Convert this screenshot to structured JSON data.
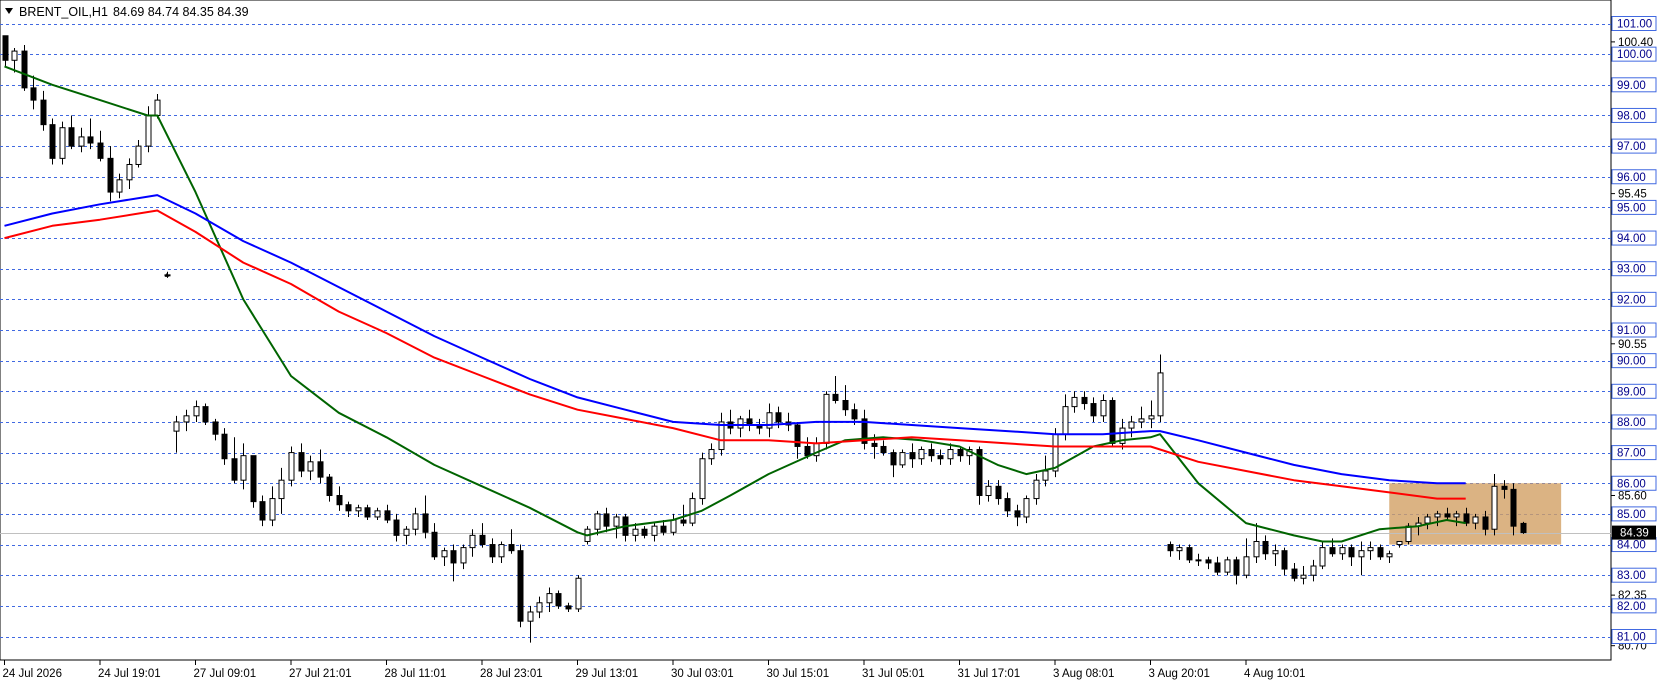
{
  "header": {
    "symbol": "BRENT_OIL,H1",
    "ohlc": "84.69 84.74 84.35 84.39"
  },
  "colors": {
    "candle": "#000000",
    "grid_line": "#4169e1",
    "ma_blue": "#0000ff",
    "ma_red": "#ff0000",
    "ma_green": "#006400",
    "zone": "#d2a064",
    "level_label_bg": "#ffffff",
    "level_label_border": "#4169e1",
    "level_label_text": "#00008b",
    "price_tag_bg": "#000000",
    "price_tag_text": "#ffffff"
  },
  "chart_data": {
    "type": "candlestick",
    "timeframe": "H1",
    "ylim": [
      80.7,
      101.3
    ],
    "current_price": 84.39,
    "level_lines": [
      101.0,
      100.0,
      99.0,
      98.0,
      97.0,
      96.0,
      95.0,
      94.0,
      93.0,
      92.0,
      91.0,
      90.0,
      89.0,
      88.0,
      87.0,
      86.0,
      85.0,
      84.0,
      83.0,
      82.0,
      81.0
    ],
    "level_labels": [
      "101.00",
      "100.00",
      "99.00",
      "98.00",
      "97.00",
      "96.00",
      "95.00",
      "94.00",
      "93.00",
      "92.00",
      "91.00",
      "90.00",
      "89.00",
      "88.00",
      "87.00",
      "86.00",
      "85.00",
      "84.00",
      "83.00",
      "82.00",
      "81.00"
    ],
    "y_ticks": [
      100.4,
      95.45,
      90.55,
      85.6,
      82.35,
      80.7
    ],
    "y_tick_labels": [
      "100.40",
      "95.45",
      "90.55",
      "85.60",
      "82.35",
      "80.70"
    ],
    "x_ticks": [
      0,
      10,
      20,
      30,
      40,
      50,
      60,
      70,
      80,
      90,
      100,
      110,
      120,
      130
    ],
    "x_tick_labels": [
      "24 Jul 2026",
      "24 Jul 19:01",
      "27 Jul 09:01",
      "27 Jul 21:01",
      "28 Jul 11:01",
      "28 Jul 23:01",
      "29 Jul 13:01",
      "30 Jul 03:01",
      "30 Jul 15:01",
      "31 Jul 05:01",
      "31 Jul 17:01",
      "3 Aug 08:01",
      "3 Aug 20:01",
      "4 Aug 10:01"
    ],
    "candles": [
      [
        100.6,
        100.6,
        99.6,
        99.8
      ],
      [
        99.8,
        100.2,
        99.4,
        100.1
      ],
      [
        100.1,
        100.3,
        98.8,
        98.9
      ],
      [
        98.9,
        99.3,
        98.2,
        98.5
      ],
      [
        98.5,
        98.8,
        97.5,
        97.7
      ],
      [
        97.7,
        97.9,
        96.4,
        96.6
      ],
      [
        96.6,
        97.8,
        96.4,
        97.6
      ],
      [
        97.6,
        98.0,
        96.9,
        97.0
      ],
      [
        97.0,
        97.6,
        96.8,
        97.3
      ],
      [
        97.3,
        97.9,
        96.9,
        97.1
      ],
      [
        97.1,
        97.5,
        96.5,
        96.6
      ],
      [
        96.6,
        97.0,
        95.2,
        95.5
      ],
      [
        95.5,
        96.1,
        95.3,
        95.9
      ],
      [
        95.9,
        96.6,
        95.6,
        96.4
      ],
      [
        96.4,
        97.2,
        96.3,
        97.0
      ],
      [
        97.0,
        98.3,
        96.8,
        98.0
      ],
      [
        98.0,
        98.7,
        97.9,
        98.5
      ],
      [
        92.8,
        92.9,
        92.7,
        92.8
      ],
      [
        87.7,
        88.2,
        87.0,
        88.0
      ],
      [
        88.0,
        88.4,
        87.7,
        88.2
      ],
      [
        88.2,
        88.7,
        88.0,
        88.5
      ],
      [
        88.5,
        88.6,
        87.9,
        88.0
      ],
      [
        88.0,
        88.1,
        87.4,
        87.6
      ],
      [
        87.6,
        87.8,
        86.6,
        86.8
      ],
      [
        86.8,
        87.5,
        86.0,
        86.1
      ],
      [
        86.1,
        87.3,
        85.8,
        86.9
      ],
      [
        86.9,
        86.9,
        85.2,
        85.4
      ],
      [
        85.4,
        85.6,
        84.6,
        84.8
      ],
      [
        84.8,
        85.9,
        84.6,
        85.5
      ],
      [
        85.5,
        86.5,
        85.0,
        86.1
      ],
      [
        86.1,
        87.2,
        85.9,
        87.0
      ],
      [
        87.0,
        87.3,
        86.2,
        86.4
      ],
      [
        86.4,
        86.9,
        86.1,
        86.7
      ],
      [
        86.7,
        87.1,
        86.0,
        86.2
      ],
      [
        86.2,
        86.3,
        85.4,
        85.6
      ],
      [
        85.6,
        85.9,
        85.1,
        85.3
      ],
      [
        85.3,
        85.4,
        84.9,
        85.1
      ],
      [
        85.1,
        85.3,
        84.9,
        85.2
      ],
      [
        85.2,
        85.3,
        84.8,
        84.9
      ],
      [
        84.9,
        85.2,
        84.8,
        85.1
      ],
      [
        85.1,
        85.3,
        84.7,
        84.8
      ],
      [
        84.8,
        85.0,
        84.1,
        84.3
      ],
      [
        84.3,
        84.6,
        84.0,
        84.5
      ],
      [
        84.5,
        85.2,
        84.3,
        85.0
      ],
      [
        85.0,
        85.6,
        84.2,
        84.4
      ],
      [
        84.4,
        84.7,
        83.5,
        83.6
      ],
      [
        83.6,
        83.9,
        83.3,
        83.8
      ],
      [
        83.8,
        84.0,
        82.8,
        83.4
      ],
      [
        83.4,
        84.0,
        83.2,
        83.9
      ],
      [
        83.9,
        84.5,
        83.6,
        84.3
      ],
      [
        84.3,
        84.7,
        83.9,
        84.0
      ],
      [
        84.0,
        84.2,
        83.4,
        83.6
      ],
      [
        83.6,
        84.1,
        83.4,
        84.0
      ],
      [
        84.0,
        84.5,
        83.7,
        83.8
      ],
      [
        83.8,
        84.0,
        81.3,
        81.5
      ],
      [
        81.5,
        82.0,
        80.8,
        81.8
      ],
      [
        81.8,
        82.3,
        81.6,
        82.1
      ],
      [
        82.1,
        82.6,
        81.8,
        82.4
      ],
      [
        82.4,
        82.5,
        81.9,
        82.0
      ],
      [
        82.0,
        82.1,
        81.8,
        81.9
      ],
      [
        81.9,
        83.0,
        81.8,
        82.9
      ],
      [
        84.1,
        84.6,
        84.0,
        84.5
      ],
      [
        84.5,
        85.1,
        84.3,
        85.0
      ],
      [
        85.0,
        85.2,
        84.4,
        84.6
      ],
      [
        84.6,
        85.0,
        84.2,
        84.9
      ],
      [
        84.9,
        85.0,
        84.1,
        84.3
      ],
      [
        84.3,
        84.7,
        84.1,
        84.5
      ],
      [
        84.5,
        84.6,
        84.2,
        84.3
      ],
      [
        84.3,
        84.7,
        84.1,
        84.6
      ],
      [
        84.6,
        84.8,
        84.3,
        84.4
      ],
      [
        84.4,
        85.0,
        84.3,
        84.8
      ],
      [
        84.8,
        85.3,
        84.6,
        84.7
      ],
      [
        84.7,
        85.7,
        84.6,
        85.5
      ],
      [
        85.5,
        87.0,
        85.3,
        86.8
      ],
      [
        86.8,
        87.3,
        86.6,
        87.1
      ],
      [
        87.1,
        88.3,
        86.9,
        88.0
      ],
      [
        88.0,
        88.4,
        87.6,
        87.8
      ],
      [
        87.8,
        88.2,
        87.5,
        88.1
      ],
      [
        88.1,
        88.4,
        87.7,
        87.9
      ],
      [
        87.9,
        88.1,
        87.6,
        87.8
      ],
      [
        87.8,
        88.6,
        87.5,
        88.3
      ],
      [
        88.3,
        88.5,
        87.8,
        88.0
      ],
      [
        88.0,
        88.3,
        87.7,
        87.9
      ],
      [
        87.9,
        88.0,
        86.8,
        87.2
      ],
      [
        87.2,
        87.5,
        86.8,
        86.9
      ],
      [
        86.9,
        87.5,
        86.7,
        87.3
      ],
      [
        87.3,
        89.0,
        87.1,
        88.9
      ],
      [
        88.9,
        89.5,
        88.6,
        88.7
      ],
      [
        88.7,
        89.2,
        88.2,
        88.4
      ],
      [
        88.4,
        88.6,
        87.9,
        88.1
      ],
      [
        88.1,
        88.4,
        87.1,
        87.3
      ],
      [
        87.3,
        87.6,
        86.8,
        87.2
      ],
      [
        87.2,
        87.4,
        86.9,
        87.0
      ],
      [
        87.0,
        87.1,
        86.2,
        86.6
      ],
      [
        86.6,
        87.1,
        86.5,
        87.0
      ],
      [
        87.0,
        87.3,
        86.5,
        86.8
      ],
      [
        86.8,
        87.2,
        86.6,
        87.1
      ],
      [
        87.1,
        87.3,
        86.7,
        86.9
      ],
      [
        86.9,
        87.1,
        86.6,
        86.8
      ],
      [
        86.8,
        87.3,
        86.6,
        87.1
      ],
      [
        87.1,
        87.2,
        86.7,
        86.9
      ],
      [
        86.9,
        87.2,
        86.6,
        87.1
      ],
      [
        87.1,
        87.2,
        85.3,
        85.6
      ],
      [
        85.6,
        86.1,
        85.4,
        85.9
      ],
      [
        85.9,
        86.1,
        85.3,
        85.5
      ],
      [
        85.5,
        85.7,
        84.9,
        85.1
      ],
      [
        85.1,
        85.3,
        84.6,
        84.9
      ],
      [
        84.9,
        85.6,
        84.7,
        85.5
      ],
      [
        85.5,
        86.3,
        85.3,
        86.1
      ],
      [
        86.1,
        86.9,
        85.9,
        86.4
      ],
      [
        86.4,
        87.8,
        86.2,
        87.6
      ],
      [
        87.6,
        88.9,
        87.4,
        88.5
      ],
      [
        88.5,
        89.0,
        88.3,
        88.8
      ],
      [
        88.8,
        89.0,
        88.4,
        88.6
      ],
      [
        88.6,
        88.8,
        88.0,
        88.2
      ],
      [
        88.2,
        88.9,
        88.0,
        88.7
      ],
      [
        88.7,
        88.8,
        87.2,
        87.3
      ],
      [
        87.3,
        88.1,
        87.1,
        87.8
      ],
      [
        87.8,
        88.2,
        87.5,
        88.0
      ],
      [
        88.0,
        88.5,
        87.8,
        88.1
      ],
      [
        88.1,
        88.7,
        87.8,
        88.2
      ],
      [
        88.2,
        90.2,
        88.0,
        89.6
      ],
      [
        84.0,
        84.1,
        83.6,
        83.8
      ],
      [
        83.8,
        84.0,
        83.5,
        83.9
      ],
      [
        83.9,
        84.0,
        83.4,
        83.5
      ],
      [
        83.5,
        83.7,
        83.3,
        83.5
      ],
      [
        83.5,
        83.6,
        83.2,
        83.4
      ],
      [
        83.4,
        83.6,
        83.0,
        83.1
      ],
      [
        83.1,
        83.6,
        83.0,
        83.5
      ],
      [
        83.5,
        83.6,
        82.7,
        83.0
      ],
      [
        83.0,
        84.2,
        82.9,
        83.6
      ],
      [
        83.6,
        84.7,
        83.4,
        84.1
      ],
      [
        84.1,
        84.3,
        83.5,
        83.7
      ],
      [
        83.7,
        84.0,
        83.3,
        83.8
      ],
      [
        83.8,
        83.9,
        83.0,
        83.2
      ],
      [
        83.2,
        83.4,
        82.8,
        82.9
      ],
      [
        82.9,
        83.3,
        82.7,
        83.0
      ],
      [
        83.0,
        83.5,
        82.8,
        83.3
      ],
      [
        83.3,
        84.1,
        83.2,
        83.9
      ],
      [
        83.9,
        84.2,
        83.6,
        83.7
      ],
      [
        83.7,
        84.0,
        83.5,
        83.9
      ],
      [
        83.9,
        84.0,
        83.3,
        83.6
      ],
      [
        83.6,
        84.1,
        83.0,
        83.8
      ],
      [
        83.8,
        84.1,
        83.5,
        83.9
      ],
      [
        83.9,
        84.0,
        83.5,
        83.6
      ],
      [
        83.6,
        83.8,
        83.4,
        83.7
      ],
      [
        84.0,
        84.1,
        83.9,
        84.1
      ],
      [
        84.1,
        84.7,
        84.0,
        84.6
      ],
      [
        84.6,
        84.9,
        84.3,
        84.7
      ],
      [
        84.7,
        85.0,
        84.5,
        84.9
      ],
      [
        84.9,
        85.1,
        84.6,
        85.0
      ],
      [
        85.0,
        85.2,
        84.8,
        84.9
      ],
      [
        84.9,
        85.1,
        84.6,
        85.0
      ],
      [
        85.0,
        85.2,
        84.6,
        84.7
      ],
      [
        84.7,
        85.0,
        84.5,
        84.9
      ],
      [
        84.9,
        85.1,
        84.3,
        84.5
      ],
      [
        84.5,
        86.3,
        84.3,
        85.9
      ],
      [
        85.9,
        86.1,
        85.5,
        85.8
      ],
      [
        85.8,
        86.0,
        84.3,
        84.6
      ],
      [
        84.69,
        84.74,
        84.35,
        84.39
      ]
    ],
    "ma_green": [
      [
        0,
        99.6
      ],
      [
        5,
        99.0
      ],
      [
        10,
        98.5
      ],
      [
        15,
        98.0
      ],
      [
        16,
        98.0
      ],
      [
        20,
        95.5
      ],
      [
        25,
        92.0
      ],
      [
        30,
        89.5
      ],
      [
        35,
        88.3
      ],
      [
        40,
        87.5
      ],
      [
        45,
        86.6
      ],
      [
        50,
        85.9
      ],
      [
        55,
        85.2
      ],
      [
        60,
        84.4
      ],
      [
        61,
        84.3
      ],
      [
        65,
        84.6
      ],
      [
        70,
        84.8
      ],
      [
        73,
        85.1
      ],
      [
        76,
        85.6
      ],
      [
        80,
        86.3
      ],
      [
        85,
        87.0
      ],
      [
        88,
        87.4
      ],
      [
        92,
        87.5
      ],
      [
        96,
        87.4
      ],
      [
        100,
        87.2
      ],
      [
        104,
        86.6
      ],
      [
        107,
        86.3
      ],
      [
        110,
        86.5
      ],
      [
        114,
        87.2
      ],
      [
        117,
        87.4
      ],
      [
        120,
        87.5
      ],
      [
        121,
        87.6
      ],
      [
        125,
        86.0
      ],
      [
        130,
        84.7
      ],
      [
        135,
        84.3
      ],
      [
        138,
        84.1
      ],
      [
        140,
        84.1
      ],
      [
        144,
        84.5
      ],
      [
        148,
        84.6
      ],
      [
        151,
        84.8
      ],
      [
        153,
        84.7
      ]
    ],
    "ma_red": [
      [
        0,
        94.0
      ],
      [
        5,
        94.4
      ],
      [
        10,
        94.6
      ],
      [
        16,
        94.9
      ],
      [
        20,
        94.2
      ],
      [
        25,
        93.2
      ],
      [
        30,
        92.5
      ],
      [
        35,
        91.6
      ],
      [
        40,
        90.9
      ],
      [
        45,
        90.1
      ],
      [
        50,
        89.5
      ],
      [
        55,
        88.9
      ],
      [
        60,
        88.4
      ],
      [
        65,
        88.1
      ],
      [
        70,
        87.8
      ],
      [
        75,
        87.4
      ],
      [
        80,
        87.4
      ],
      [
        85,
        87.3
      ],
      [
        90,
        87.4
      ],
      [
        95,
        87.5
      ],
      [
        100,
        87.4
      ],
      [
        105,
        87.3
      ],
      [
        110,
        87.2
      ],
      [
        115,
        87.2
      ],
      [
        120,
        87.2
      ],
      [
        121,
        87.1
      ],
      [
        125,
        86.7
      ],
      [
        130,
        86.4
      ],
      [
        135,
        86.1
      ],
      [
        140,
        85.9
      ],
      [
        145,
        85.7
      ],
      [
        150,
        85.5
      ],
      [
        153,
        85.5
      ]
    ],
    "ma_blue": [
      [
        0,
        94.4
      ],
      [
        5,
        94.8
      ],
      [
        10,
        95.1
      ],
      [
        16,
        95.4
      ],
      [
        20,
        94.8
      ],
      [
        25,
        93.9
      ],
      [
        30,
        93.2
      ],
      [
        35,
        92.4
      ],
      [
        40,
        91.6
      ],
      [
        45,
        90.8
      ],
      [
        50,
        90.1
      ],
      [
        55,
        89.4
      ],
      [
        60,
        88.8
      ],
      [
        65,
        88.4
      ],
      [
        70,
        88.0
      ],
      [
        75,
        87.9
      ],
      [
        80,
        87.9
      ],
      [
        85,
        88.0
      ],
      [
        90,
        88.0
      ],
      [
        95,
        87.9
      ],
      [
        100,
        87.8
      ],
      [
        105,
        87.7
      ],
      [
        110,
        87.6
      ],
      [
        115,
        87.6
      ],
      [
        120,
        87.7
      ],
      [
        121,
        87.7
      ],
      [
        125,
        87.4
      ],
      [
        130,
        87.0
      ],
      [
        135,
        86.6
      ],
      [
        140,
        86.3
      ],
      [
        145,
        86.1
      ],
      [
        150,
        86.0
      ],
      [
        153,
        86.0
      ]
    ],
    "zone": {
      "x_start": 145,
      "x_end": 163,
      "y_low": 84.0,
      "y_high": 86.0
    },
    "marker": {
      "x": 17,
      "y": 92.8
    }
  }
}
